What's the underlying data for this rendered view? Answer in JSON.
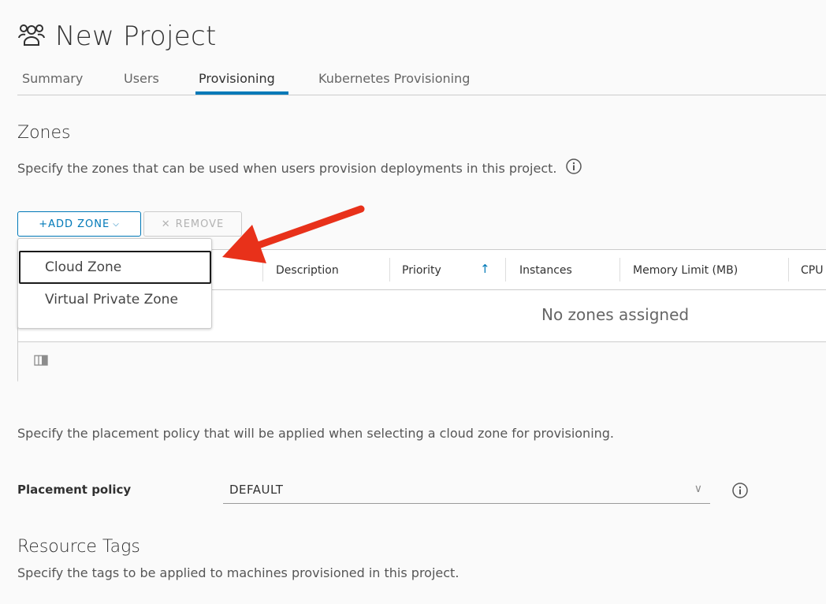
{
  "header": {
    "title": "New Project",
    "icon": "users-icon"
  },
  "tabs": [
    {
      "label": "Summary",
      "active": false
    },
    {
      "label": "Users",
      "active": false
    },
    {
      "label": "Provisioning",
      "active": true
    },
    {
      "label": "Kubernetes Provisioning",
      "active": false
    }
  ],
  "zones": {
    "heading": "Zones",
    "description": "Specify the zones that can be used when users provision deployments in this project.",
    "add_zone_label": "+ADD ZONE",
    "remove_label": "REMOVE",
    "dropdown": {
      "items": [
        "Cloud Zone",
        "Virtual Private Zone"
      ]
    },
    "table": {
      "columns": [
        "Description",
        "Priority",
        "Instances",
        "Memory Limit (MB)",
        "CPU"
      ],
      "empty_text": "No zones assigned"
    }
  },
  "placement": {
    "description": "Specify the placement policy that will be applied when selecting a cloud zone for provisioning.",
    "label": "Placement policy",
    "value": "DEFAULT"
  },
  "resource_tags": {
    "heading": "Resource Tags",
    "description": "Specify the tags to be applied to machines provisioned in this project."
  },
  "colors": {
    "accent": "#0079b8",
    "annotation_arrow": "#e8311a"
  }
}
